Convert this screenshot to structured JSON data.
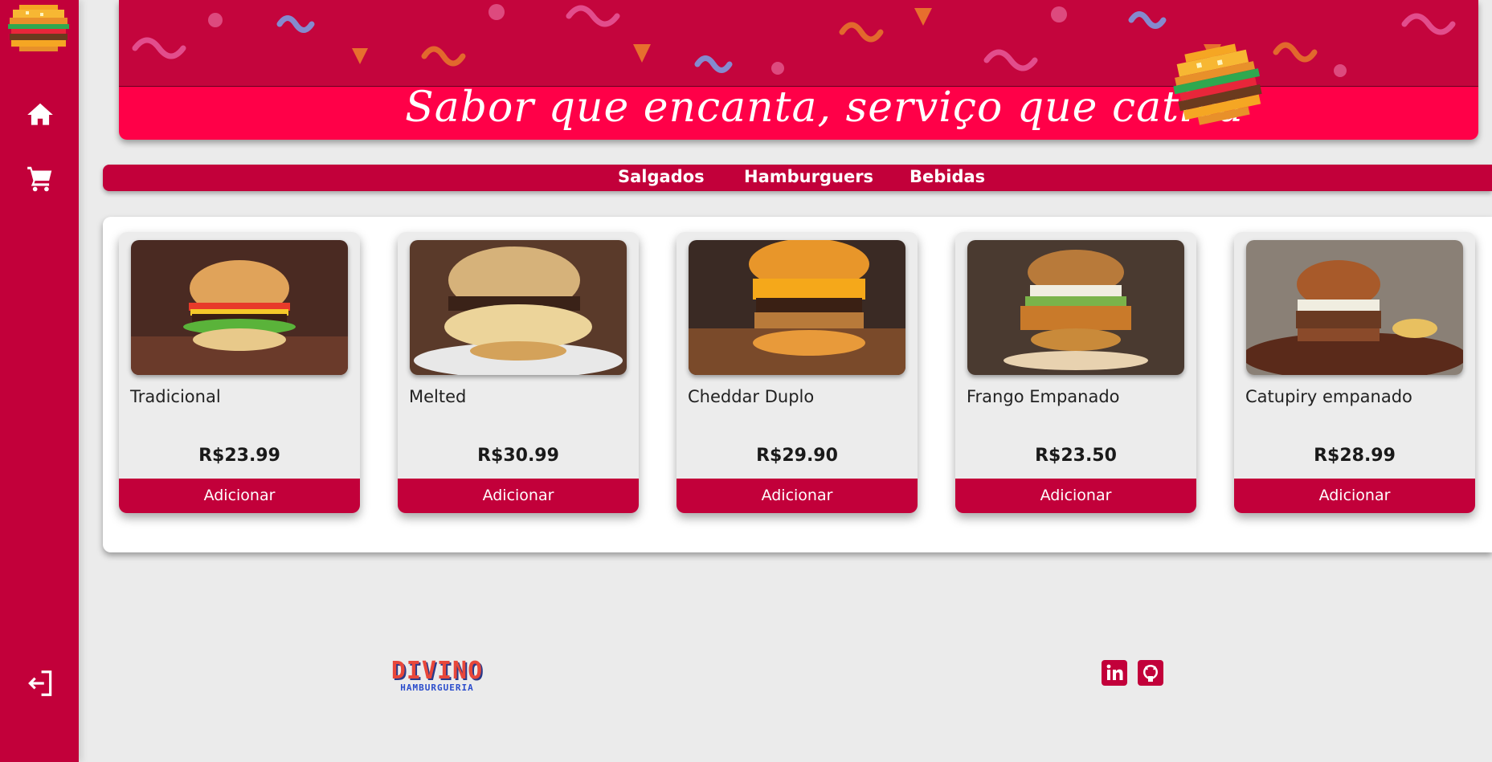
{
  "banner": {
    "slogan": "Sabor que encanta, serviço que cativa"
  },
  "sidebar": {
    "items": [
      {
        "icon": "home-icon",
        "label": "Início"
      },
      {
        "icon": "cart-icon",
        "label": "Carrinho"
      },
      {
        "icon": "logout-icon",
        "label": "Sair"
      }
    ]
  },
  "categories": [
    "Salgados",
    "Hamburguers",
    "Bebidas"
  ],
  "products": [
    {
      "name": "Tradicional",
      "price": "R$23.99",
      "button": "Adicionar"
    },
    {
      "name": "Melted",
      "price": "R$30.99",
      "button": "Adicionar"
    },
    {
      "name": "Cheddar Duplo",
      "price": "R$29.90",
      "button": "Adicionar"
    },
    {
      "name": "Frango Empanado",
      "price": "R$23.50",
      "button": "Adicionar"
    },
    {
      "name": "Catupiry empanado",
      "price": "R$28.99",
      "button": "Adicionar"
    }
  ],
  "footer": {
    "logo_main": "DIVINO",
    "logo_sub": "HAMBURGUERIA",
    "social": [
      {
        "icon": "linkedin-icon",
        "label": "LinkedIn"
      },
      {
        "icon": "github-icon",
        "label": "GitHub"
      }
    ]
  },
  "colors": {
    "primary": "#c2003a",
    "banner_strip": "#ff0048",
    "background": "#ebebeb"
  }
}
